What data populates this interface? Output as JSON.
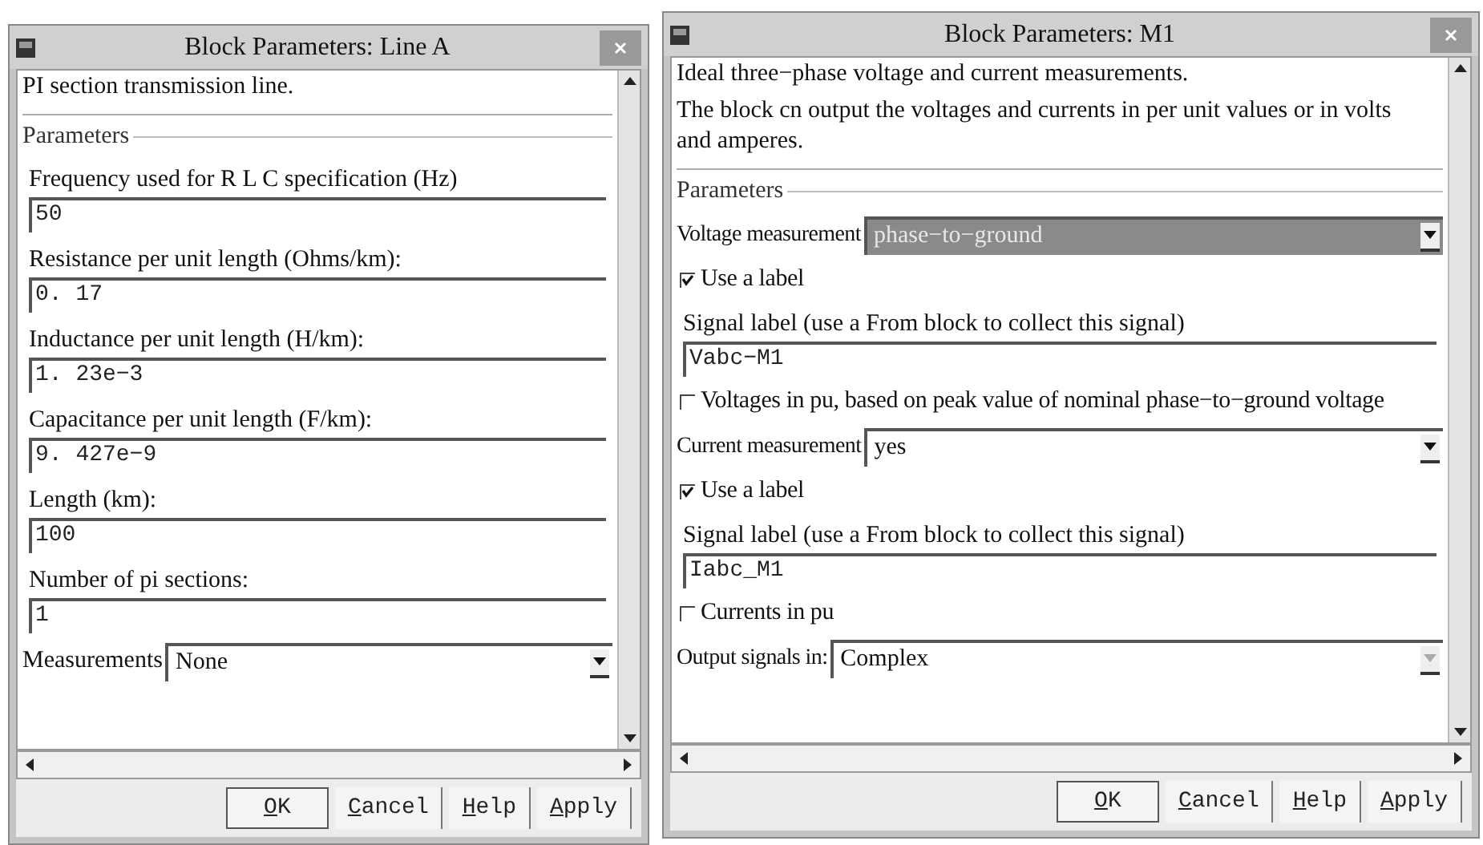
{
  "windows": [
    {
      "title": "Block Parameters: Line A",
      "description": [
        "PI section transmission line."
      ],
      "group_label": "Parameters",
      "fields": [
        {
          "kind": "text",
          "label": "Frequency used for R L C specification (Hz)",
          "value": "50"
        },
        {
          "kind": "text",
          "label": "Resistance per unit length (Ohms/km):",
          "value": "0. 17"
        },
        {
          "kind": "text",
          "label": "Inductance per unit length (H/km):",
          "value": "1. 23e−3"
        },
        {
          "kind": "text",
          "label": "Capacitance per unit length (F/km):",
          "value": "9. 427e−9"
        },
        {
          "kind": "text",
          "label": "Length (km):",
          "value": "100"
        },
        {
          "kind": "text",
          "label": "Number of pi sections:",
          "value": "1"
        },
        {
          "kind": "dropdown",
          "label": "Measurements",
          "value": "None",
          "highlighted": false,
          "disabled": false
        }
      ],
      "buttons": [
        "OK",
        "Cancel",
        "Help",
        "Apply"
      ]
    },
    {
      "title": "Block Parameters: M1",
      "description": [
        "Ideal three−phase voltage and current measurements.",
        "The block cn output the voltages and currents in per unit values or in volts and amperes."
      ],
      "group_label": "Parameters",
      "fields": [
        {
          "kind": "dropdown",
          "label": "Voltage measurement",
          "value": "phase−to−ground",
          "highlighted": true,
          "disabled": false
        },
        {
          "kind": "checkbox",
          "label": "Use a label",
          "checked": true
        },
        {
          "kind": "text",
          "label": "Signal label (use a From block to collect this signal)",
          "value": "Vabc−M1"
        },
        {
          "kind": "checkbox",
          "label": "Voltages in pu, based on peak value of nominal phase−to−ground voltage",
          "checked": false
        },
        {
          "kind": "dropdown",
          "label": "Current measurement",
          "value": "yes",
          "highlighted": false,
          "disabled": false
        },
        {
          "kind": "checkbox",
          "label": "Use a label",
          "checked": true
        },
        {
          "kind": "text",
          "label": "Signal label (use a From block to collect this signal)",
          "value": "Iabc_M1"
        },
        {
          "kind": "checkbox",
          "label": "Currents in pu",
          "checked": false
        },
        {
          "kind": "dropdown",
          "label": "Output signals in:",
          "value": "Complex",
          "highlighted": false,
          "disabled": true
        }
      ],
      "buttons": [
        "OK",
        "Cancel",
        "Help",
        "Apply"
      ]
    }
  ]
}
